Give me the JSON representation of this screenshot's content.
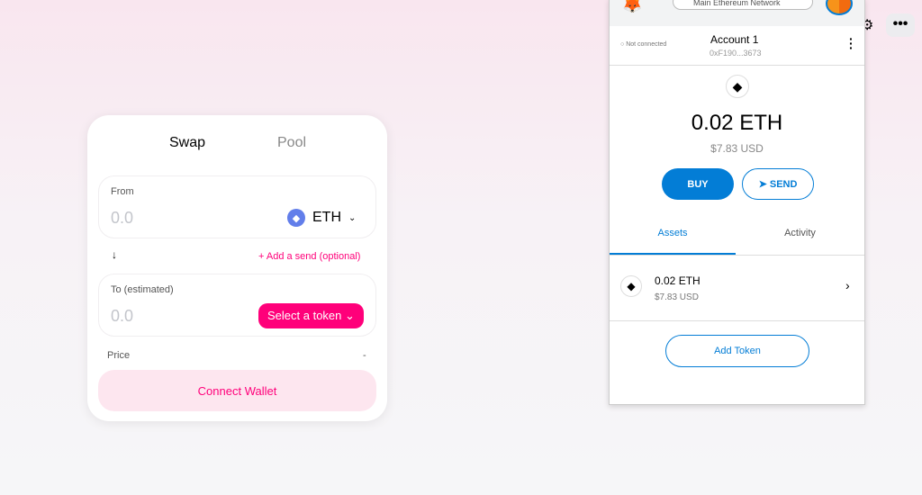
{
  "swap": {
    "tabs": [
      "Swap",
      "Pool"
    ],
    "from_label": "From",
    "from_value": "0.0",
    "from_token": "ETH",
    "add_send": "+ Add a send (optional)",
    "to_label": "To (estimated)",
    "to_value": "0.0",
    "select_token": "Select a token",
    "price_label": "Price",
    "price_value": "-",
    "connect": "Connect Wallet"
  },
  "metamask": {
    "network": "Main Ethereum Network",
    "status": "Not connected",
    "account": "Account 1",
    "address": "0xF190...3673",
    "balance": "0.02",
    "balance_unit": "ETH",
    "usd": "$7.83 USD",
    "buy": "BUY",
    "send": "SEND",
    "tabs": [
      "Assets",
      "Activity"
    ],
    "asset_amount": "0.02 ETH",
    "asset_usd": "$7.83 USD",
    "add_token": "Add Token"
  },
  "colors": {
    "accent": "#ff007a",
    "mm_blue": "#037dd6"
  }
}
